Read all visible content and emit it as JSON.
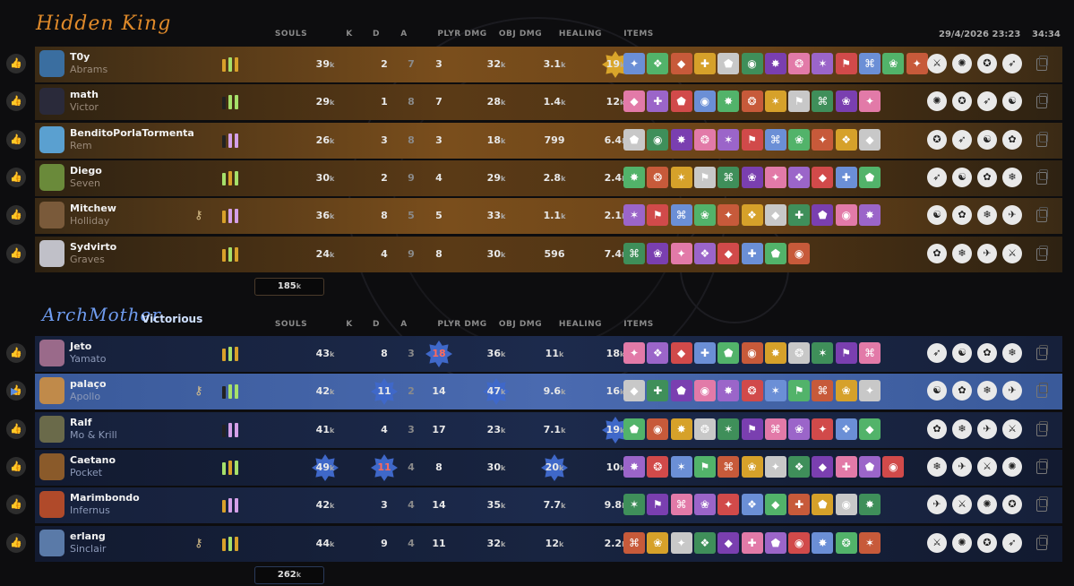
{
  "header": {
    "datetime": "29/4/2026 23:23",
    "clock": "34:34"
  },
  "columns": {
    "souls": "SOULS",
    "k": "K",
    "d": "D",
    "a": "A",
    "plyr_dmg": "PLYR DMG",
    "obj_dmg": "OBJ DMG",
    "healing": "HEALING",
    "items": "ITEMS"
  },
  "colors": {
    "orange_team": "#c9853c",
    "blue_team": "#5e88d8",
    "highlight_star": "#d9a52a",
    "blue_star": "#3f68c9"
  },
  "teams": [
    {
      "name": "Hidden King",
      "subtitle": "",
      "total_souls": "185",
      "players": [
        {
          "name": "T0y",
          "hero": "Abrams",
          "souls": "39",
          "k": "2",
          "d": "7",
          "a": "3",
          "plyr_dmg": "32",
          "obj_dmg": "3.1",
          "healing": "19",
          "icon": "bull-avatar"
        },
        {
          "name": "math",
          "hero": "Victor",
          "souls": "29",
          "k": "1",
          "d": "8",
          "a": "7",
          "plyr_dmg": "28",
          "obj_dmg": "1.4",
          "healing": "12",
          "icon": "victor-avatar"
        },
        {
          "name": "BenditoPorlaTormenta",
          "hero": "Rem",
          "souls": "26",
          "k": "3",
          "d": "8",
          "a": "3",
          "plyr_dmg": "18",
          "obj_dmg": "799",
          "healing": "6.4",
          "icon": "rem-avatar"
        },
        {
          "name": "Diego",
          "hero": "Seven",
          "souls": "30",
          "k": "2",
          "d": "9",
          "a": "4",
          "plyr_dmg": "29",
          "obj_dmg": "2.8",
          "healing": "2.4",
          "icon": "seven-avatar"
        },
        {
          "name": "Mitchew",
          "hero": "Holliday",
          "souls": "36",
          "k": "8",
          "d": "5",
          "a": "5",
          "plyr_dmg": "33",
          "obj_dmg": "1.1",
          "healing": "2.1",
          "icon": "holliday-avatar"
        },
        {
          "name": "Sydvirto",
          "hero": "Graves",
          "souls": "24",
          "k": "4",
          "d": "9",
          "a": "8",
          "plyr_dmg": "30",
          "obj_dmg": "596",
          "healing": "7.4",
          "icon": "graves-avatar"
        }
      ]
    },
    {
      "name": "ArchMother",
      "subtitle": "Victorious",
      "total_souls": "262",
      "players": [
        {
          "name": "Jeto",
          "hero": "Yamato",
          "souls": "43",
          "k": "8",
          "d": "3",
          "a": "18",
          "plyr_dmg": "36",
          "obj_dmg": "11",
          "healing": "18",
          "icon": "yamato-avatar"
        },
        {
          "name": "palaço",
          "hero": "Apollo",
          "souls": "42",
          "k": "11",
          "d": "2",
          "a": "14",
          "plyr_dmg": "47",
          "obj_dmg": "9.6",
          "healing": "16",
          "icon": "apollo-avatar"
        },
        {
          "name": "Ralf",
          "hero": "Mo & Krill",
          "souls": "41",
          "k": "4",
          "d": "3",
          "a": "17",
          "plyr_dmg": "23",
          "obj_dmg": "7.1",
          "healing": "19",
          "icon": "mokrill-avatar"
        },
        {
          "name": "Caetano",
          "hero": "Pocket",
          "souls": "49",
          "k": "11",
          "d": "4",
          "a": "8",
          "plyr_dmg": "30",
          "obj_dmg": "20",
          "healing": "10",
          "icon": "pocket-avatar"
        },
        {
          "name": "Marimbondo",
          "hero": "Infernus",
          "souls": "42",
          "k": "3",
          "d": "4",
          "a": "14",
          "plyr_dmg": "35",
          "obj_dmg": "7.7",
          "healing": "9.8",
          "icon": "infernus-avatar"
        },
        {
          "name": "erlang",
          "hero": "Sinclair",
          "souls": "44",
          "k": "9",
          "d": "4",
          "a": "11",
          "plyr_dmg": "32",
          "obj_dmg": "12",
          "healing": "2.2",
          "icon": "sinclair-avatar"
        }
      ]
    }
  ]
}
